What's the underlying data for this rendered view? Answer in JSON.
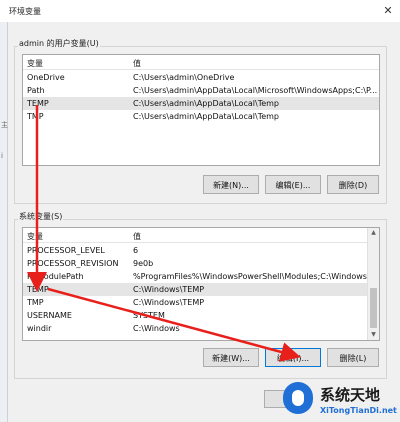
{
  "window": {
    "title": "环境变量",
    "close_glyph": "✕"
  },
  "left_strip": {
    "chars": [
      "主",
      "i"
    ]
  },
  "user_vars": {
    "group_label": "admin 的用户变量(U)",
    "headers": {
      "variable": "变量",
      "value": "值"
    },
    "rows": [
      {
        "name": "OneDrive",
        "value": "C:\\Users\\admin\\OneDrive"
      },
      {
        "name": "Path",
        "value": "C:\\Users\\admin\\AppData\\Local\\Microsoft\\WindowsApps;C:\\P..."
      },
      {
        "name": "TEMP",
        "value": "C:\\Users\\admin\\AppData\\Local\\Temp"
      },
      {
        "name": "TMP",
        "value": "C:\\Users\\admin\\AppData\\Local\\Temp"
      }
    ],
    "selected_index": 2,
    "buttons": {
      "new": "新建(N)...",
      "edit": "编辑(E)...",
      "delete": "删除(D)"
    }
  },
  "system_vars": {
    "group_label": "系统变量(S)",
    "headers": {
      "variable": "变量",
      "value": "值"
    },
    "rows": [
      {
        "name": "PROCESSOR_LEVEL",
        "value": "6"
      },
      {
        "name": "PROCESSOR_REVISION",
        "value": "9e0b"
      },
      {
        "name": "PSModulePath",
        "value": "%ProgramFiles%\\WindowsPowerShell\\Modules;C:\\Windows\\..."
      },
      {
        "name": "TEMP",
        "value": "C:\\Windows\\TEMP"
      },
      {
        "name": "TMP",
        "value": "C:\\Windows\\TEMP"
      },
      {
        "name": "USERNAME",
        "value": "SYSTEM"
      },
      {
        "name": "windir",
        "value": "C:\\Windows"
      }
    ],
    "selected_index": 3,
    "buttons": {
      "new": "新建(W)...",
      "edit": "编辑(I)...",
      "delete": "删除(L)"
    }
  },
  "watermark": {
    "name": "系统天地",
    "url": "XiTongTianDi.net"
  },
  "colors": {
    "arrow": "#e8201c",
    "selection": "#e5e5e5",
    "focus": "#0078d7",
    "brand": "#1f6fd6"
  },
  "icons": [
    "close-icon",
    "scroll-up-icon",
    "scroll-down-icon",
    "annotation-arrow",
    "watermark-shield-icon"
  ]
}
